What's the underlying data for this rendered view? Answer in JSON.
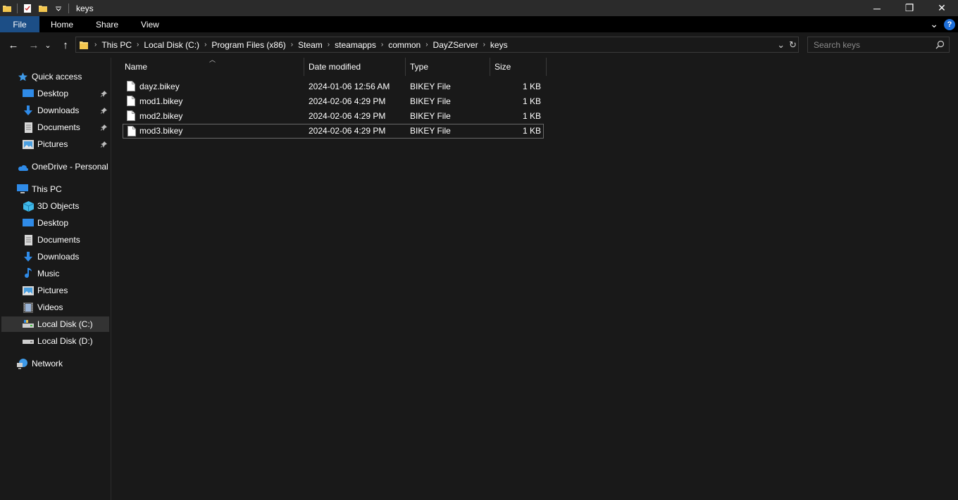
{
  "window": {
    "title": "keys",
    "controls": {
      "minimize": "─",
      "maximize": "❐",
      "close": "✕"
    }
  },
  "ribbon": {
    "tabs": [
      "File",
      "Home",
      "Share",
      "View"
    ],
    "expand_glyph": "⌄",
    "help_glyph": "?"
  },
  "nav": {
    "back": "←",
    "forward": "→",
    "recent": "⌄",
    "up": "↑"
  },
  "address": {
    "crumbs": [
      "This PC",
      "Local Disk (C:)",
      "Program Files (x86)",
      "Steam",
      "steamapps",
      "common",
      "DayZServer",
      "keys"
    ],
    "separator": "›",
    "dropdown": "⌄",
    "refresh": "↻"
  },
  "search": {
    "placeholder": "Search keys"
  },
  "sidebar": {
    "quick_access": "Quick access",
    "quick_items": [
      "Desktop",
      "Downloads",
      "Documents",
      "Pictures"
    ],
    "onedrive": "OneDrive - Personal",
    "this_pc": "This PC",
    "pc_items": [
      "3D Objects",
      "Desktop",
      "Documents",
      "Downloads",
      "Music",
      "Pictures",
      "Videos",
      "Local Disk (C:)",
      "Local Disk (D:)"
    ],
    "network": "Network"
  },
  "columns": {
    "name": "Name",
    "date": "Date modified",
    "type": "Type",
    "size": "Size"
  },
  "files": [
    {
      "name": "dayz.bikey",
      "date": "2024-01-06 12:56 AM",
      "type": "BIKEY File",
      "size": "1 KB"
    },
    {
      "name": "mod1.bikey",
      "date": "2024-02-06 4:29 PM",
      "type": "BIKEY File",
      "size": "1 KB"
    },
    {
      "name": "mod2.bikey",
      "date": "2024-02-06 4:29 PM",
      "type": "BIKEY File",
      "size": "1 KB"
    },
    {
      "name": "mod3.bikey",
      "date": "2024-02-06 4:29 PM",
      "type": "BIKEY File",
      "size": "1 KB"
    }
  ],
  "colors": {
    "background": "#191919",
    "titlebar": "#2b2b2b",
    "ribbon": "#000000",
    "file_tab": "#1c4e86",
    "accent_blue": "#1e6fd9",
    "folder_yellow": "#f8d775",
    "selected_item": "#333333"
  }
}
